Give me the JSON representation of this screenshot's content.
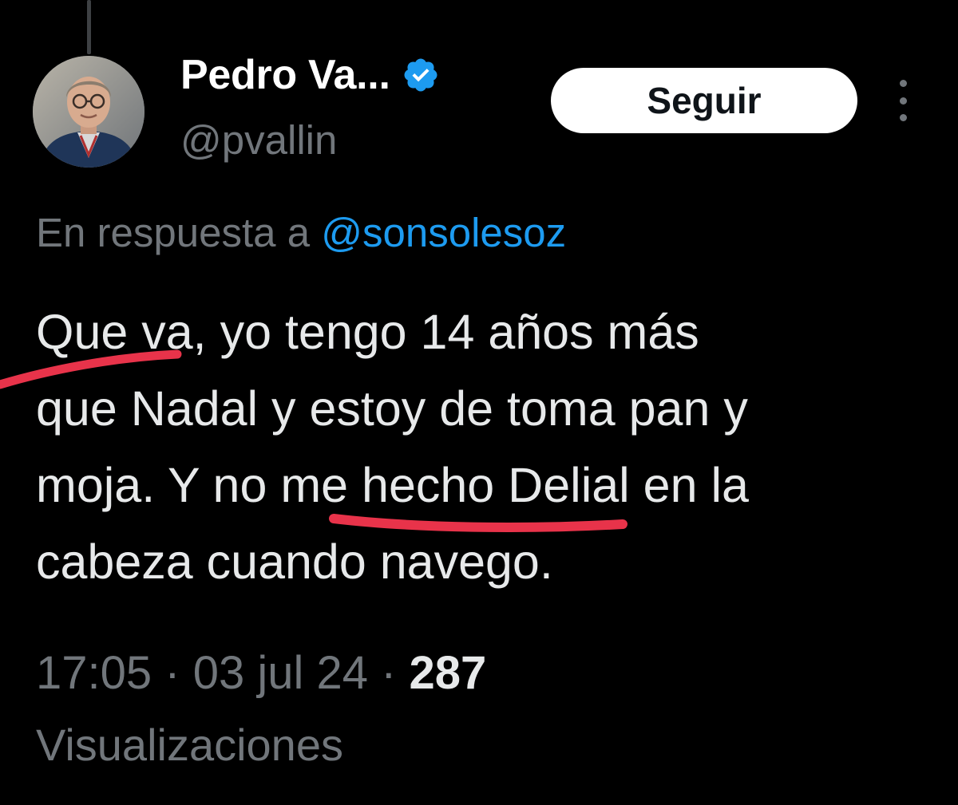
{
  "colors": {
    "background": "#000000",
    "primary_text": "#e7e9ea",
    "secondary_text": "#71767b",
    "link": "#1d9bf0",
    "verified_badge": "#1d9bf0",
    "follow_button_bg": "#ffffff",
    "annotation_underline": "#e8334a"
  },
  "author": {
    "display_name": "Pedro Va...",
    "handle": "@pvallin",
    "verified": true,
    "avatar_icon": "profile-photo"
  },
  "follow_button": {
    "label": "Seguir"
  },
  "more_icon": "vertical-ellipsis-icon",
  "reply_context": {
    "prefix": "En respuesta a",
    "mention": "@sonsolesoz"
  },
  "tweet": {
    "lines": [
      "Que va, yo tengo 14 años más",
      "que Nadal y estoy de toma pan y",
      "moja. Y no me hecho Delial en la",
      "cabeza cuando navego."
    ]
  },
  "meta": {
    "time": "17:05",
    "separator": " · ",
    "date": "03 jul 24",
    "views_count": "287",
    "views_label": "Visualizaciones"
  }
}
